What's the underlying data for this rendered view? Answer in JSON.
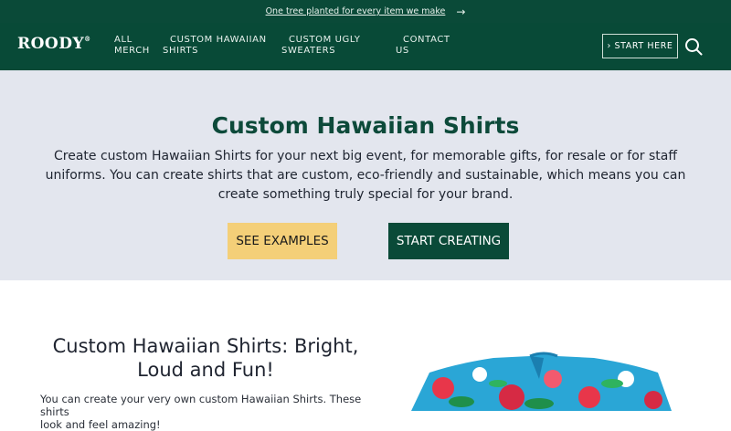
{
  "announcement": {
    "text": "One tree planted for every item we make"
  },
  "nav": {
    "logo": "ROODY",
    "items": [
      {
        "line1": "ALL",
        "line2": "MERCH"
      },
      {
        "line1": "CUSTOM HAWAIIAN",
        "line2": "SHIRTS"
      },
      {
        "line1": "CUSTOM UGLY",
        "line2": "SWEATERS"
      },
      {
        "line1": "CONTACT",
        "line2": "US"
      }
    ],
    "start_here": "› START HERE"
  },
  "hero": {
    "title": "Custom Hawaiian Shirts",
    "body": "Create custom Hawaiian Shirts for your next big event, for memorable gifts, for resale or for staff uniforms. You can create shirts that are custom, eco-friendly and sustainable, which means you can create something truly special for your brand.",
    "see_examples": "SEE EXAMPLES",
    "start_creating": "START CREATING"
  },
  "section": {
    "title_line1": "Custom Hawaiian Shirts: Bright,",
    "title_line2": "Loud and Fun!",
    "text_line1": "You can create your very own custom Hawaiian Shirts. These shirts",
    "text_line2": "look and feel amazing!"
  },
  "colors": {
    "brand_green": "#0a4a38",
    "accent_yellow": "#f4cf78",
    "hero_bg": "#e3e6ee"
  }
}
